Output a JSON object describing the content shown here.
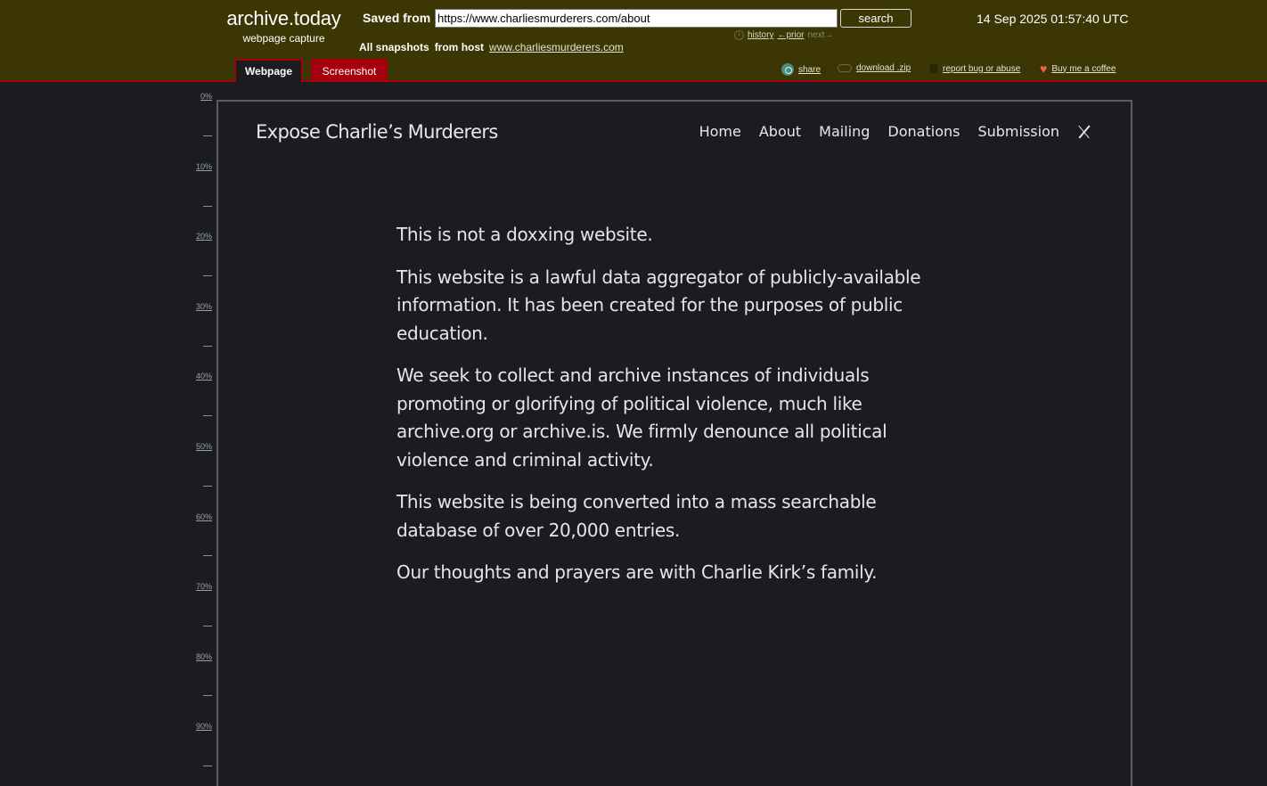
{
  "archive": {
    "brand_title": "archive.today",
    "brand_subtitle": "webpage capture",
    "saved_from_label": "Saved from",
    "url_value": "https://www.charliesmurderers.com/about",
    "search_label": "search",
    "timestamp": "14 Sep 2025 01:57:40 UTC",
    "history_label": "history",
    "prior_label": "←prior",
    "next_label": "next→",
    "all_snapshots_label": "All snapshots",
    "from_host_label": "from host",
    "host_link": "www.charliesmurderers.com",
    "tabs": [
      {
        "label": "Webpage",
        "active": true
      },
      {
        "label": "Screenshot",
        "active": false
      }
    ],
    "tools": {
      "share": "share",
      "download": "download .zip",
      "report": "report bug or abuse",
      "coffee": "Buy me a coffee"
    }
  },
  "ruler": {
    "marks": [
      "0%",
      "10%",
      "20%",
      "30%",
      "40%",
      "50%",
      "60%",
      "70%",
      "80%",
      "90%"
    ]
  },
  "site": {
    "title": "Expose Charlie’s Murderers",
    "nav": [
      "Home",
      "About",
      "Mailing",
      "Donations",
      "Submission"
    ],
    "paragraphs": [
      "This is not a doxxing website.",
      "This website is a lawful data aggregator of publicly-available information. It has been created for the purposes of public education.",
      "We seek to collect and archive instances of individuals promoting or glorifying of political violence, much like archive.org or archive.is. We firmly denounce all political violence and criminal activity.",
      "This website is being converted into a mass searchable database of over 20,000 entries.",
      "Our thoughts and prayers are with Charlie Kirk’s family."
    ]
  },
  "colors": {
    "header_bg": "#3b3604",
    "accent_red": "#a6000d",
    "page_bg": "#1b1c1f",
    "text_light": "#e6e6e8"
  }
}
